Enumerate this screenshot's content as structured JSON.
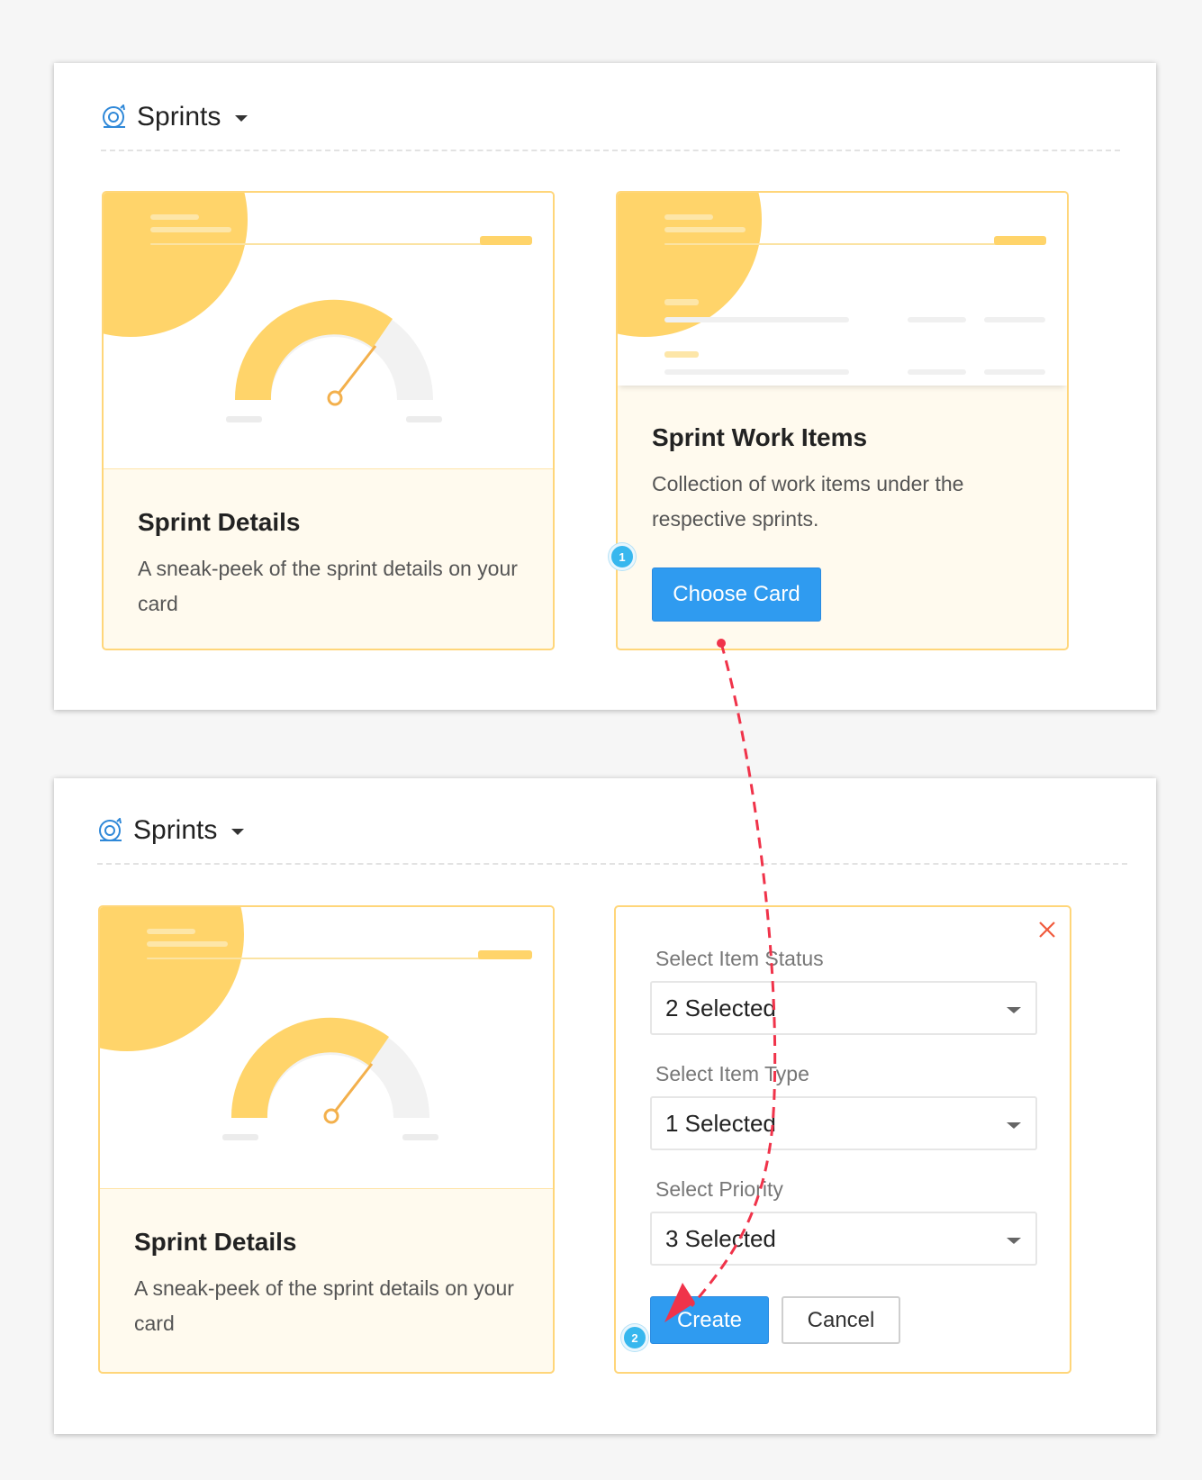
{
  "panels": [
    {
      "header": {
        "title": "Sprints"
      },
      "cards": [
        {
          "title": "Sprint Details",
          "description": "A sneak-peek of the sprint details on your card"
        },
        {
          "title": "Sprint Work Items",
          "description": "Collection of work items under the respective sprints.",
          "button_label": "Choose Card",
          "step_badge": "1"
        }
      ]
    },
    {
      "header": {
        "title": "Sprints"
      },
      "card": {
        "title": "Sprint Details",
        "description": "A sneak-peek of the sprint details on your card"
      },
      "form": {
        "fields": [
          {
            "label": "Select Item Status",
            "value": "2 Selected"
          },
          {
            "label": "Select Item Type",
            "value": "1 Selected"
          },
          {
            "label": "Select Priority",
            "value": "3 Selected"
          }
        ],
        "create_label": "Create",
        "cancel_label": "Cancel",
        "step_badge": "2"
      }
    }
  ],
  "colors": {
    "accent": "#2f9bf0",
    "card_border": "#ffd67a",
    "card_bg": "#fffaee",
    "gauge": "#ffd46a",
    "arrow": "#f0334a",
    "close": "#f05a3c",
    "badge": "#37b7ee"
  },
  "icons": [
    "sprints-icon",
    "chevron-down-icon",
    "close-icon",
    "gauge-icon",
    "arrow-flow"
  ]
}
